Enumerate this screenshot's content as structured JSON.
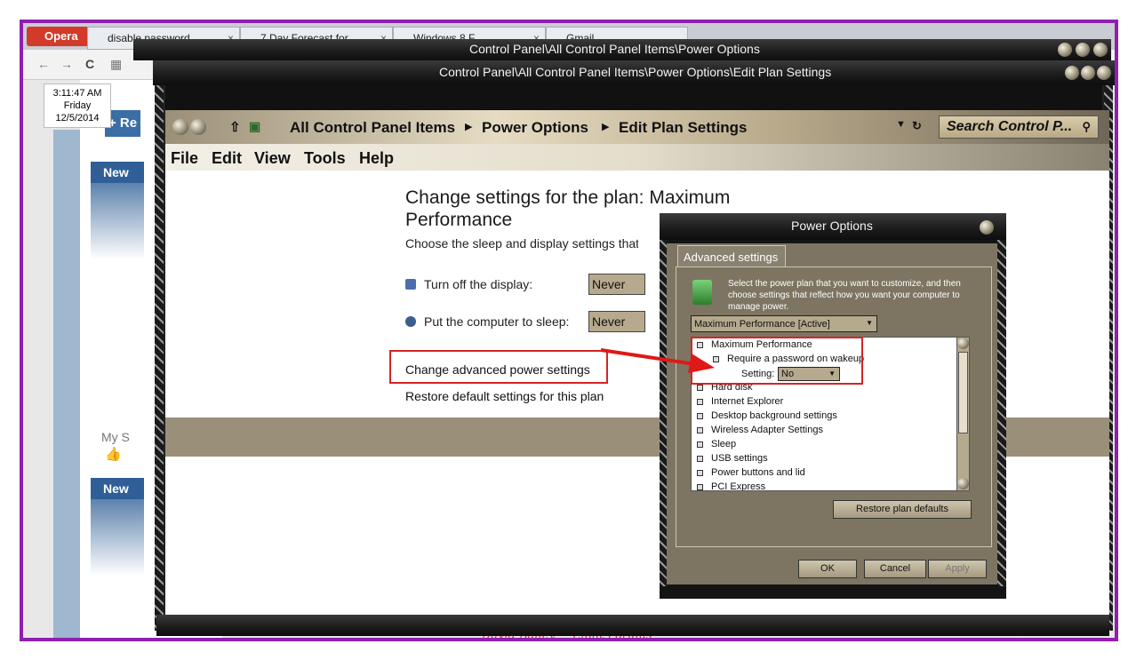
{
  "browser": {
    "opera_label": "Opera",
    "tabs": [
      {
        "label": "disable password"
      },
      {
        "label": "7 Day Forecast for"
      },
      {
        "label": "Windows 8 F"
      },
      {
        "label": "Gmail"
      }
    ],
    "clock": {
      "time": "3:11:47 AM",
      "day": "Friday",
      "date": "12/5/2014"
    },
    "reply_label": "+ Re",
    "new_label_1": "New",
    "new_label_2": "New",
    "my_s_label": "My S"
  },
  "window_back": {
    "title": "Control Panel\\All Control Panel Items\\Power Options"
  },
  "window_main": {
    "title": "Control Panel\\All Control Panel Items\\Power Options\\Edit Plan Settings",
    "breadcrumbs": [
      "All Control Panel Items",
      "Power Options",
      "Edit Plan Settings"
    ],
    "search_placeholder": "Search Control P...",
    "menu": [
      "File",
      "Edit",
      "View",
      "Tools",
      "Help"
    ],
    "heading": "Change settings for the plan: Maximum Performance",
    "subheading": "Choose the sleep and display settings that",
    "display_label": "Turn off the display:",
    "display_value": "Never",
    "sleep_label": "Put the computer to sleep:",
    "sleep_value": "Never",
    "advanced_link": "Change advanced power settings",
    "restore_link": "Restore default settings for this plan",
    "signature": "David Bailey ~ Eight Forums"
  },
  "dialog": {
    "title": "Power Options",
    "tab": "Advanced settings",
    "description": "Select the power plan that you want to customize, and then choose settings that reflect how you want your computer to manage power.",
    "plan_select": "Maximum Performance [Active]",
    "tree": {
      "root": "Maximum Performance",
      "child": "Require a password on wakeup",
      "setting_label": "Setting:",
      "setting_value": "No",
      "items": [
        "Hard disk",
        "Internet Explorer",
        "Desktop background settings",
        "Wireless Adapter Settings",
        "Sleep",
        "USB settings",
        "Power buttons and lid",
        "PCI Express"
      ]
    },
    "restore_button": "Restore plan defaults",
    "ok": "OK",
    "cancel": "Cancel",
    "apply": "Apply"
  },
  "colors": {
    "frame": "#8e1fb0",
    "highlight": "#d72323",
    "panel": "#7d7562"
  }
}
